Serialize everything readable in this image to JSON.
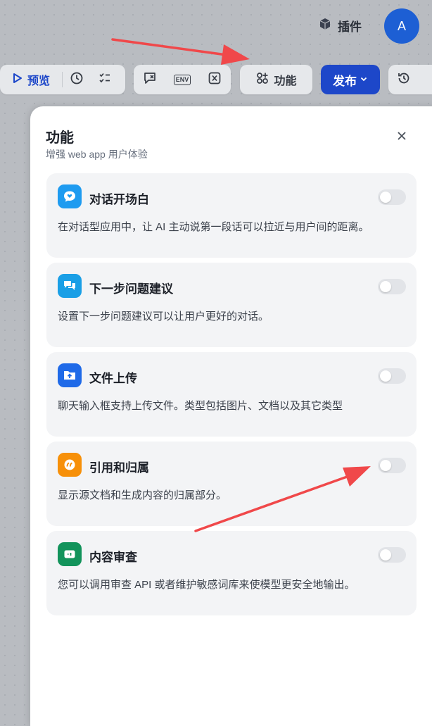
{
  "header": {
    "plugin_label": "插件",
    "avatar_initial": "A"
  },
  "toolbar": {
    "preview_label": "预览",
    "env_label": "ENV",
    "features_label": "功能",
    "publish_label": "发布"
  },
  "panel": {
    "title": "功能",
    "subtitle": "增强 web app 用户体验",
    "cards": [
      {
        "title": "对话开场白",
        "desc": "在对话型应用中，让 AI 主动说第一段话可以拉近与用户间的距离。",
        "icon": "chat-heart-icon",
        "color": "#1e9bf0",
        "enabled": false
      },
      {
        "title": "下一步问题建议",
        "desc": "设置下一步问题建议可以让用户更好的对话。",
        "icon": "chat-bubbles-icon",
        "color": "#1a9fe6",
        "enabled": false
      },
      {
        "title": "文件上传",
        "desc": "聊天输入框支持上传文件。类型包括图片、文档以及其它类型",
        "icon": "folder-upload-icon",
        "color": "#1f6ae8",
        "enabled": false
      },
      {
        "title": "引用和归属",
        "desc": "显示源文档和生成内容的归属部分。",
        "icon": "quote-icon",
        "color": "#f79009",
        "enabled": false
      },
      {
        "title": "内容审查",
        "desc": "您可以调用审查 API 或者维护敏感词库来使模型更安全地输出。",
        "icon": "moderation-icon",
        "color": "#12935b",
        "enabled": false
      }
    ]
  },
  "colors": {
    "accent": "#1d47c9",
    "annotation_arrow": "#f0484a"
  }
}
